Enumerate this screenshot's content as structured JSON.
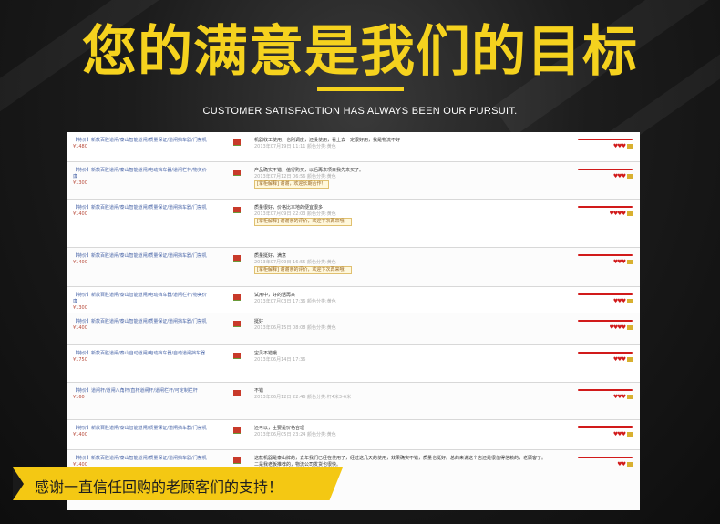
{
  "header": {
    "title": "您的满意是我们的目标",
    "subtitle": "CUSTOMER SATISFACTION HAS ALWAYS BEEN OUR PURSUIT.",
    "accent_color": "#f5d21e"
  },
  "banner": {
    "text": "感谢一直信任回购的老顾客们的支持！",
    "color": "#f4c813"
  },
  "reviews": [
    {
      "product": "【特价】新款百胜道闸/泰山智能道闸/质量保证/道闸挡车器/门禁机",
      "price": "¥1480",
      "comment": "机器收工使用，也刚调度，还没使用，看上去一定很好用，我是物流不好",
      "date": "2013年07月19日 11:11 颜色分类:黄色",
      "reply": "",
      "hearts": "♥♥♥"
    },
    {
      "product": "【特价】新款百胜道闸/泰山智能道闸/电动挡车器/道闸栏杆/物美价廉",
      "price": "¥1300",
      "comment": "产品确实不错，值得购买，以后再来项目我先来买了。",
      "date": "2013年07月12日 06:56 颜色分类:黄色",
      "reply": "[掌柜解释] 谢谢，欢迎长期合作！",
      "hearts": "♥♥♥"
    },
    {
      "product": "【特价】新款百胜道闸/泰山智能道闸/质量保证/道闸挡车器/门禁机",
      "price": "¥1400",
      "comment": "质量很好，价格比本地的便宜很多！",
      "date": "2013年07月09日 22:03 颜色分类:黄色",
      "reply": "[掌柜解释] 谢谢亲的评价，欢迎下次再来哦！",
      "hearts": "♥♥♥♥"
    },
    {
      "product": "【特价】新款百胜道闸/泰山智能道闸/质量保证/道闸挡车器/门禁机",
      "price": "¥1400",
      "comment": "质量挺好，满意",
      "date": "2013年07月09日 16:55 颜色分类:黄色",
      "reply": "[掌柜解释] 谢谢亲的评价，欢迎下次再来哦！",
      "hearts": "♥♥♥"
    },
    {
      "product": "【特价】新款百胜道闸/泰山智能道闸/电动挡车器/道闸栏杆/物美价廉",
      "price": "¥1300",
      "comment": "试用中，好的话再来",
      "date": "2013年07月03日 17:36 颜色分类:黄色",
      "reply": "",
      "hearts": "♥♥♥"
    },
    {
      "product": "【特价】新款百胜道闸/泰山智能道闸/质量保证/道闸挡车器/门禁机",
      "price": "¥1400",
      "comment": "挺好",
      "date": "2013年06月15日 08:08 颜色分类:黄色",
      "reply": "",
      "hearts": "♥♥♥♥"
    },
    {
      "product": "【特价】新款百胜道闸/泰山自动道闸/电动挡车器/自动道闸挡车器",
      "price": "¥1750",
      "comment": "宝贝不错哦",
      "date": "2013年06月14日 17:36",
      "reply": "",
      "hearts": "♥♥♥"
    },
    {
      "product": "【特价】道闸杆/道闸八角杆/直杆道闸杆/道闸栏杆/可定制栏杆",
      "price": "¥160",
      "comment": "不错",
      "date": "2013年06月12日 22:46 颜色分类:杆4米3-6米",
      "reply": "",
      "hearts": "♥♥♥"
    },
    {
      "product": "【特价】新款百胜道闸/泰山智能道闸/质量保证/道闸挡车器/门禁机",
      "price": "¥1400",
      "comment": "还可以，主要是价格合理",
      "date": "2013年06月05日 23:24 颜色分类:黄色",
      "reply": "",
      "hearts": "♥♥♥"
    },
    {
      "product": "【特价】新款百胜道闸/泰山智能道闸/质量保证/道闸挡车器/门禁机",
      "price": "¥1400",
      "comment": "这款机器是泰山牌的，去年我们已经在使用了，经过这几天的使用，效果确实不错，质量也挺好。总的来说这个店还是很值得信赖的，老顾客了。二是我老板推荐的，物流公司发货也很快。",
      "date": "",
      "reply": "",
      "hearts": "♥♥"
    }
  ]
}
